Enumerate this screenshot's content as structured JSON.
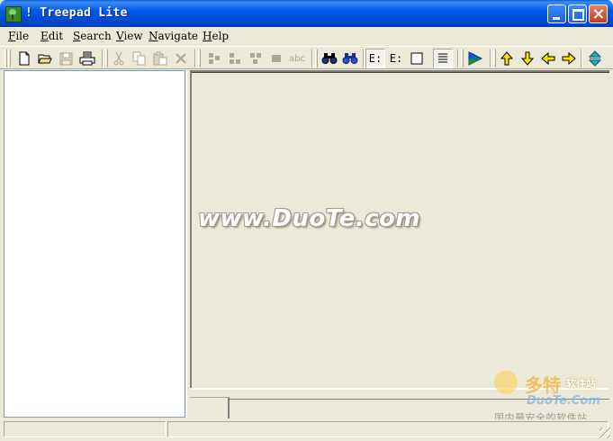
{
  "window": {
    "title": "! Treepad Lite"
  },
  "menu": {
    "items": [
      {
        "key": "F",
        "rest": "ile"
      },
      {
        "key": "E",
        "rest": "dit"
      },
      {
        "key": "S",
        "rest": "earch"
      },
      {
        "key": "V",
        "rest": "iew"
      },
      {
        "key": "N",
        "rest": "avigate"
      },
      {
        "key": "H",
        "rest": "elp"
      }
    ]
  },
  "toolbar": {
    "buttons": [
      {
        "name": "new-icon",
        "enabled": true
      },
      {
        "name": "open-folder-icon",
        "enabled": true
      },
      {
        "name": "save-icon",
        "enabled": false
      },
      {
        "name": "print-icon",
        "enabled": true
      },
      {
        "name": "cut-icon",
        "enabled": false
      },
      {
        "name": "copy-icon",
        "enabled": false
      },
      {
        "name": "paste-icon",
        "enabled": false
      },
      {
        "name": "delete-icon",
        "enabled": false
      },
      {
        "name": "insert-node-before-icon",
        "enabled": false
      },
      {
        "name": "insert-node-after-icon",
        "enabled": false
      },
      {
        "name": "insert-child-icon",
        "enabled": false
      },
      {
        "name": "node-icon",
        "enabled": false
      },
      {
        "name": "spellcheck-icon",
        "enabled": false
      },
      {
        "name": "find-icon",
        "enabled": true
      },
      {
        "name": "find-next-icon",
        "enabled": true
      },
      {
        "name": "tree-view-icon",
        "enabled": true
      },
      {
        "name": "tree-collapse-icon",
        "enabled": true
      },
      {
        "name": "blank-page-icon",
        "enabled": true
      },
      {
        "name": "word-wrap-icon",
        "enabled": true
      },
      {
        "name": "play-icon",
        "enabled": true
      },
      {
        "name": "arrow-up-icon",
        "enabled": true
      },
      {
        "name": "arrow-down-icon",
        "enabled": true
      },
      {
        "name": "arrow-left-icon",
        "enabled": true
      },
      {
        "name": "arrow-right-icon",
        "enabled": true
      },
      {
        "name": "up-down-icon",
        "enabled": true
      }
    ],
    "spellcheck_glyph": "abc",
    "tree_glyph": "E:"
  },
  "colors": {
    "title_bar": "#0058E6",
    "face": "#ECE9D8",
    "arrow_yellow": "#FFE600",
    "play_blue": "#0A60D8",
    "binoculars": "#1C2F8A"
  },
  "watermark": {
    "site": "www.DuoTe.com",
    "logo_cn": "多特",
    "logo_cn_small": "软件站",
    "logo_en": "DuoTe.Com",
    "slogan": "国内最安全的软件站"
  },
  "statusbar": {
    "left": "",
    "right": ""
  }
}
